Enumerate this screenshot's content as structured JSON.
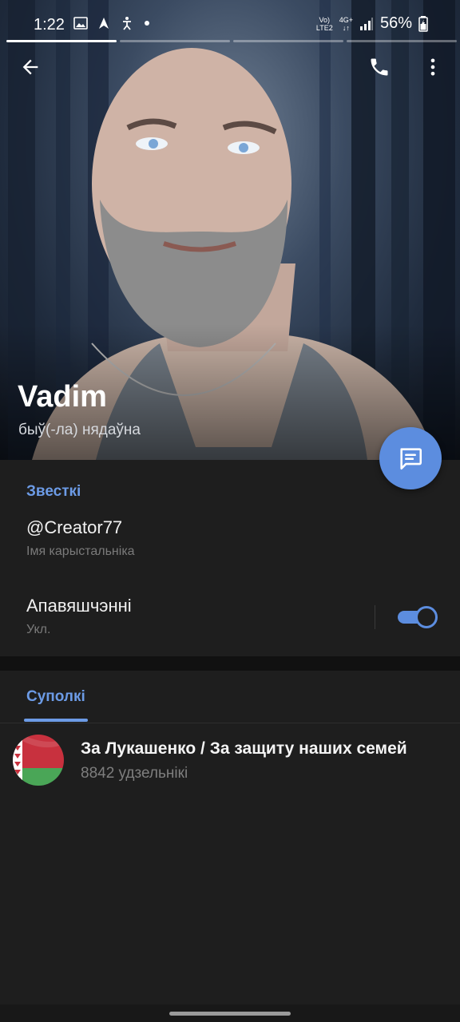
{
  "status_bar": {
    "time": "1:22",
    "network_top": "Vo)",
    "network_bottom": "LTE2",
    "data_top": "4G+",
    "data_bottom": "↓↑",
    "battery": "56%",
    "icons": [
      "gallery-icon",
      "navigation-icon",
      "accessibility-icon",
      "dot-icon",
      "signal-icon",
      "battery-icon"
    ]
  },
  "story_progress": {
    "segments": 4,
    "active_index": 0
  },
  "header": {
    "back_icon": "arrow-left-icon",
    "call_icon": "phone-icon",
    "more_icon": "more-vertical-icon",
    "name": "Vadim",
    "last_seen": "быў(-ла) нядаўна"
  },
  "fab": {
    "icon": "message-icon",
    "color": "#5c8ddf"
  },
  "info": {
    "title": "Звесткі",
    "username": "@Creator77",
    "username_caption": "Імя карыстальніка",
    "notifications_label": "Апавяшчэнні",
    "notifications_caption": "Укл.",
    "notifications_on": true
  },
  "tabs": [
    {
      "label": "Суполкі",
      "active": true
    }
  ],
  "groups": [
    {
      "title": "За Лукашенко / За защиту наших семей",
      "members": "8842 удзельнікі",
      "avatar": "belarus-flag-icon"
    }
  ],
  "colors": {
    "accent": "#6c9be6",
    "background": "#1e1e1e",
    "fab": "#5c8ddf"
  }
}
